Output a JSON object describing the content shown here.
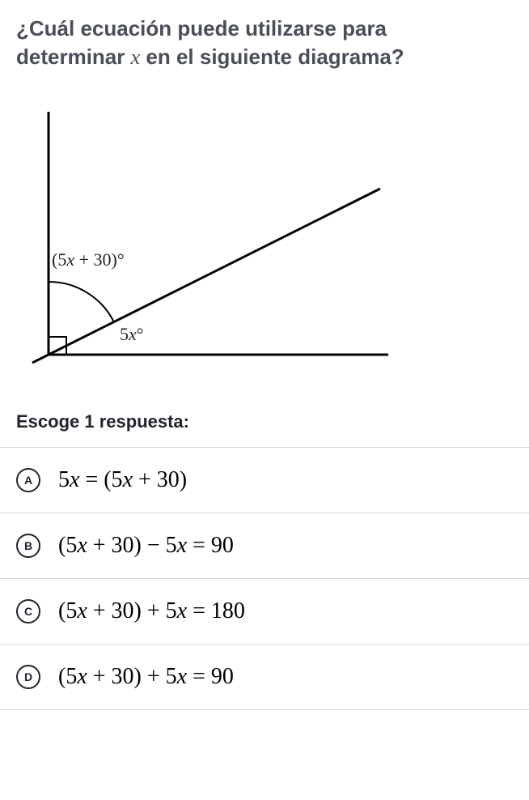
{
  "question": {
    "line1": "¿Cuál ecuación puede utilizarse para",
    "line2_pre": "determinar ",
    "line2_var": "x",
    "line2_post": " en el siguiente diagrama?"
  },
  "diagram": {
    "angle_upper_pre": "(5",
    "angle_upper_var": "x",
    "angle_upper_post": " + 30)°",
    "angle_lower_pre": "5",
    "angle_lower_var": "x",
    "angle_lower_post": "°"
  },
  "instruction": "Escoge 1 respuesta:",
  "choices": [
    {
      "letter": "A",
      "lhs_pre": "5",
      "lhs_var": "x",
      "lhs_post": " = (5",
      "rhs_var": "x",
      "rhs_post": " + 30)"
    },
    {
      "letter": "B",
      "lhs_pre": "(5",
      "lhs_var": "x",
      "lhs_post": " + 30) − 5",
      "rhs_var": "x",
      "rhs_post": " = 90"
    },
    {
      "letter": "C",
      "lhs_pre": "(5",
      "lhs_var": "x",
      "lhs_post": " + 30) + 5",
      "rhs_var": "x",
      "rhs_post": " = 180"
    },
    {
      "letter": "D",
      "lhs_pre": "(5",
      "lhs_var": "x",
      "lhs_post": " + 30) + 5",
      "rhs_var": "x",
      "rhs_post": " = 90"
    }
  ]
}
